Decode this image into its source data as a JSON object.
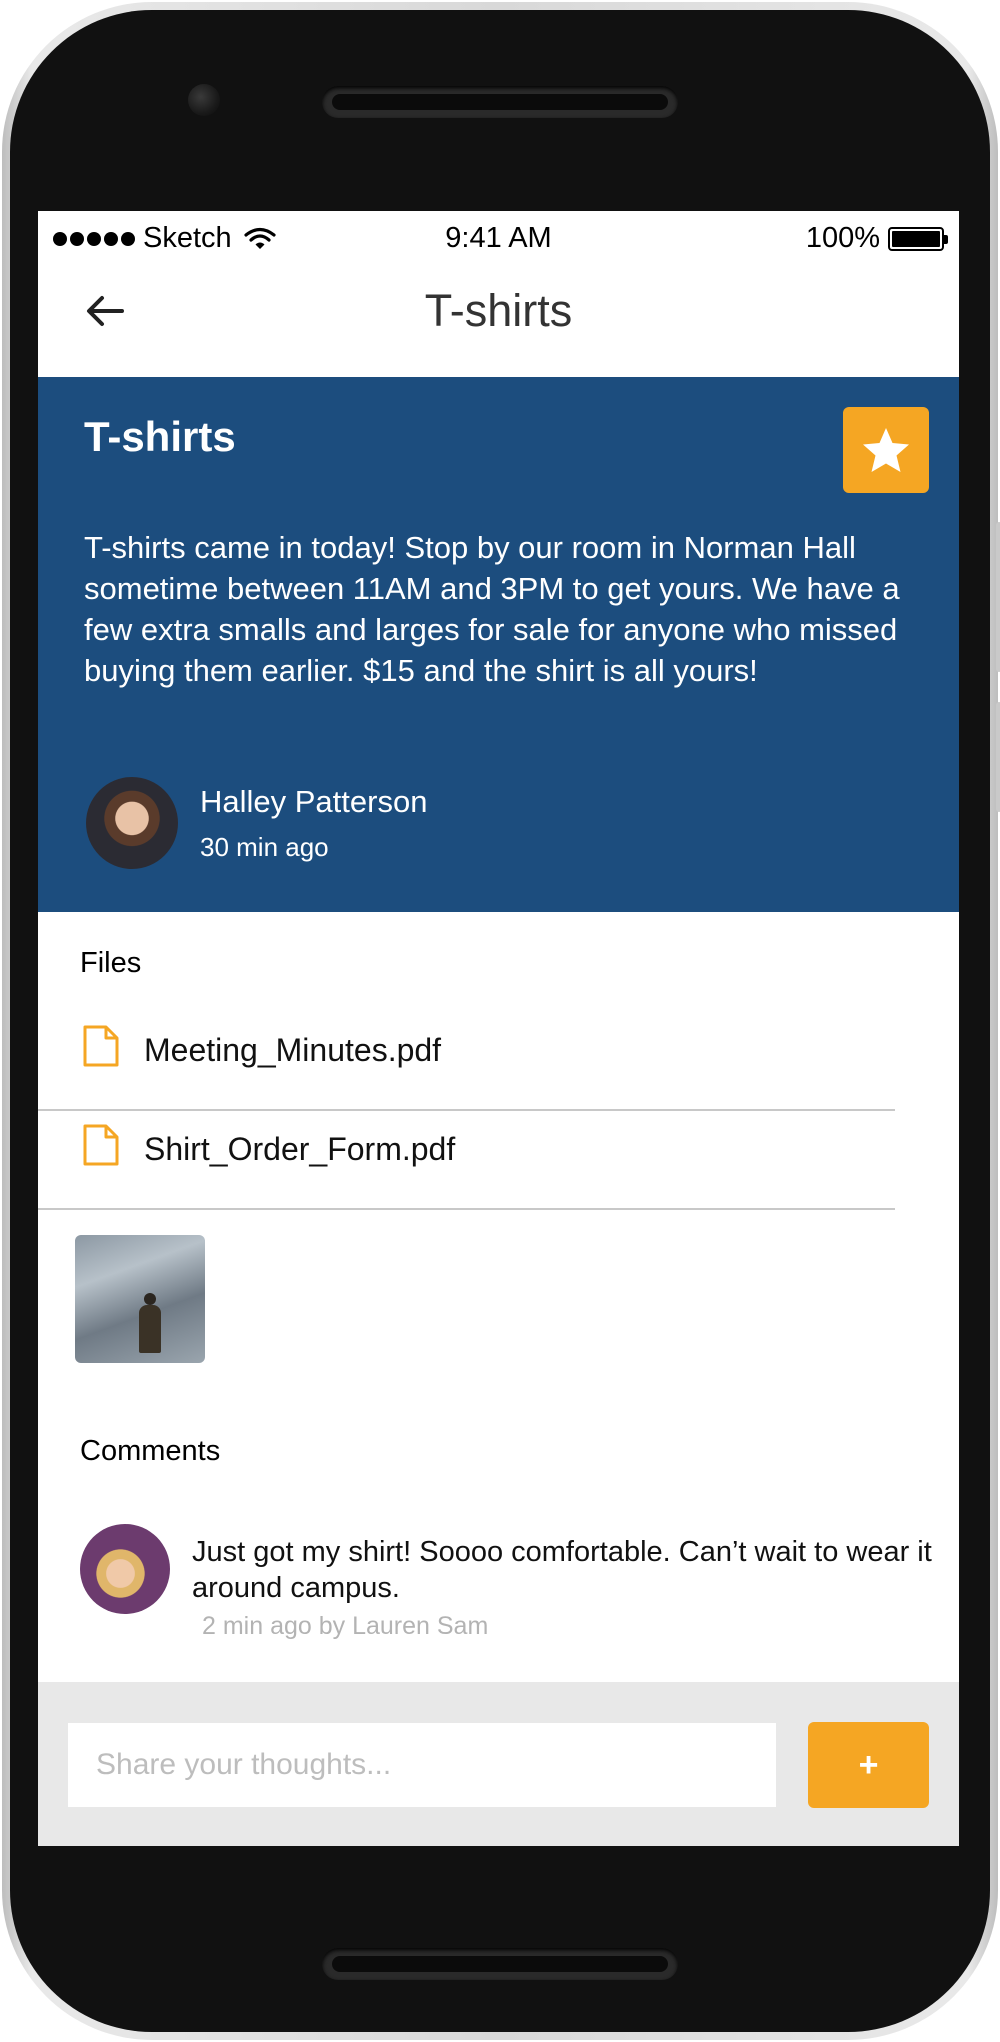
{
  "status_bar": {
    "carrier": "Sketch",
    "time": "9:41 AM",
    "battery": "100%",
    "icons": [
      "signal-dots-icon",
      "wifi-icon",
      "battery-icon"
    ]
  },
  "nav": {
    "back_icon": "back-arrow-icon",
    "title": "T-shirts"
  },
  "post": {
    "title": "T-shirts",
    "star_icon": "star-icon",
    "body": "T-shirts came in today!  Stop by our room in Norman Hall sometime between 11AM and 3PM to get yours.  We have a few extra smalls and larges for sale for anyone who missed buying them earlier.  $15 and the shirt is all yours!",
    "author_name": "Halley Patterson",
    "author_time": "30 min ago"
  },
  "files": {
    "label": "Files",
    "items": [
      {
        "name": "Meeting_Minutes.pdf",
        "icon": "file-icon"
      },
      {
        "name": "Shirt_Order_Form.pdf",
        "icon": "file-icon"
      }
    ]
  },
  "comments": {
    "label": "Comments",
    "items": [
      {
        "text": "Just got my shirt!  Soooo comfortable.  Can’t wait to wear it around campus.",
        "meta": "2 min ago by Lauren Sam"
      }
    ]
  },
  "composer": {
    "placeholder": "Share your thoughts...",
    "button_label": "+"
  },
  "colors": {
    "post_background": "#1c4d7e",
    "accent": "#f5a623",
    "composer_background": "#e8e8e8"
  }
}
